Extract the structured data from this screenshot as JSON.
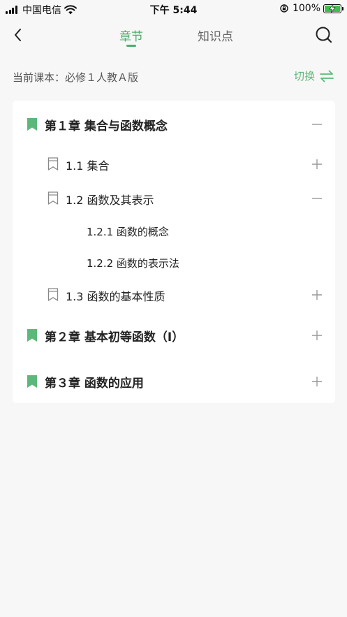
{
  "status_bar": {
    "carrier": "中国电信",
    "time": "下午 5:44",
    "battery": "100%"
  },
  "nav": {
    "tabs": [
      {
        "label": "章节",
        "active": true
      },
      {
        "label": "知识点",
        "active": false
      }
    ],
    "accent_color": "#4cae6b"
  },
  "course": {
    "label": "当前课本：必修１人教Ａ版",
    "switch_label": "切换"
  },
  "tree": [
    {
      "id": "ch1",
      "level": "chapter",
      "label": "第１章 集合与函数概念",
      "expanded": true
    },
    {
      "id": "s11",
      "level": "section",
      "label": "1.1 集合",
      "expanded": false
    },
    {
      "id": "s12",
      "level": "section",
      "label": "1.2 函数及其表示",
      "expanded": true
    },
    {
      "id": "s121",
      "level": "subsection",
      "label": "1.2.1 函数的概念"
    },
    {
      "id": "s122",
      "level": "subsection",
      "label": "1.2.2 函数的表示法"
    },
    {
      "id": "s13",
      "level": "section",
      "label": "1.3 函数的基本性质",
      "expanded": false
    },
    {
      "id": "ch2",
      "level": "chapter",
      "label": "第２章 基本初等函数（Ⅰ）",
      "expanded": false
    },
    {
      "id": "ch3",
      "level": "chapter",
      "label": "第３章 函数的应用",
      "expanded": false
    }
  ]
}
